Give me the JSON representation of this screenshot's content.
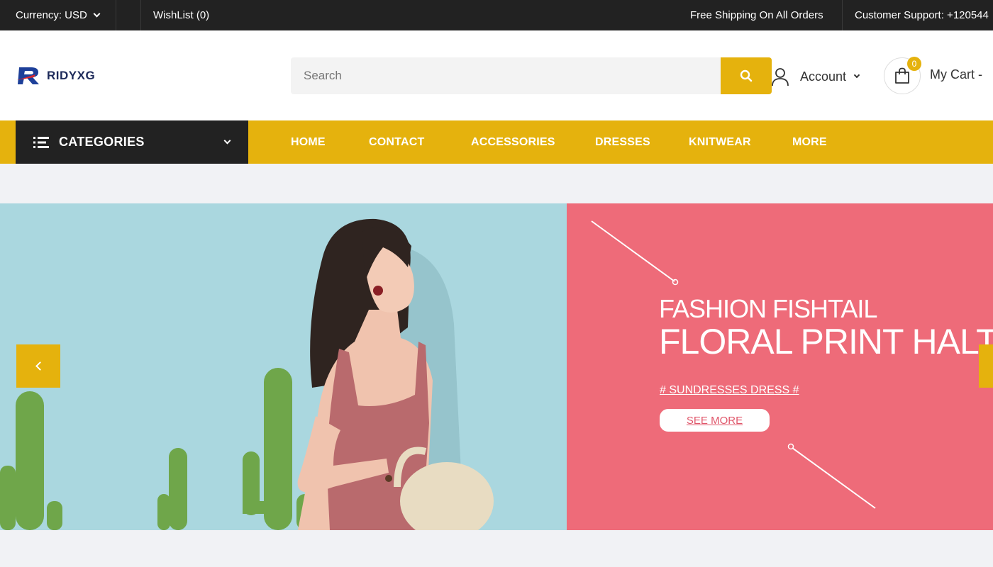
{
  "topbar": {
    "currency": "Currency: USD",
    "wishlist": "WishList (0)",
    "shipping": "Free Shipping On All Orders",
    "support": "Customer Support: +120544"
  },
  "header": {
    "logo_text": "RIDYXG",
    "search_placeholder": "Search",
    "account_label": "Account",
    "cart_count": "0",
    "cart_label": "My Cart -"
  },
  "nav": {
    "categories_label": "CATEGORIES",
    "links": [
      "HOME",
      "CONTACT",
      "ACCESSORIES",
      "DRESSES",
      "KNITWEAR",
      "MORE"
    ]
  },
  "hero": {
    "title_small": "FASHION FISHTAIL",
    "title_big": "FLORAL PRINT HALTER",
    "tagline": "# SUNDRESSES DRESS #",
    "button_label": "SEE MORE"
  },
  "colors": {
    "accent": "#e5b20d",
    "dark": "#222222",
    "hero_pink": "#ee6b79",
    "hero_blue": "#aad7df"
  }
}
